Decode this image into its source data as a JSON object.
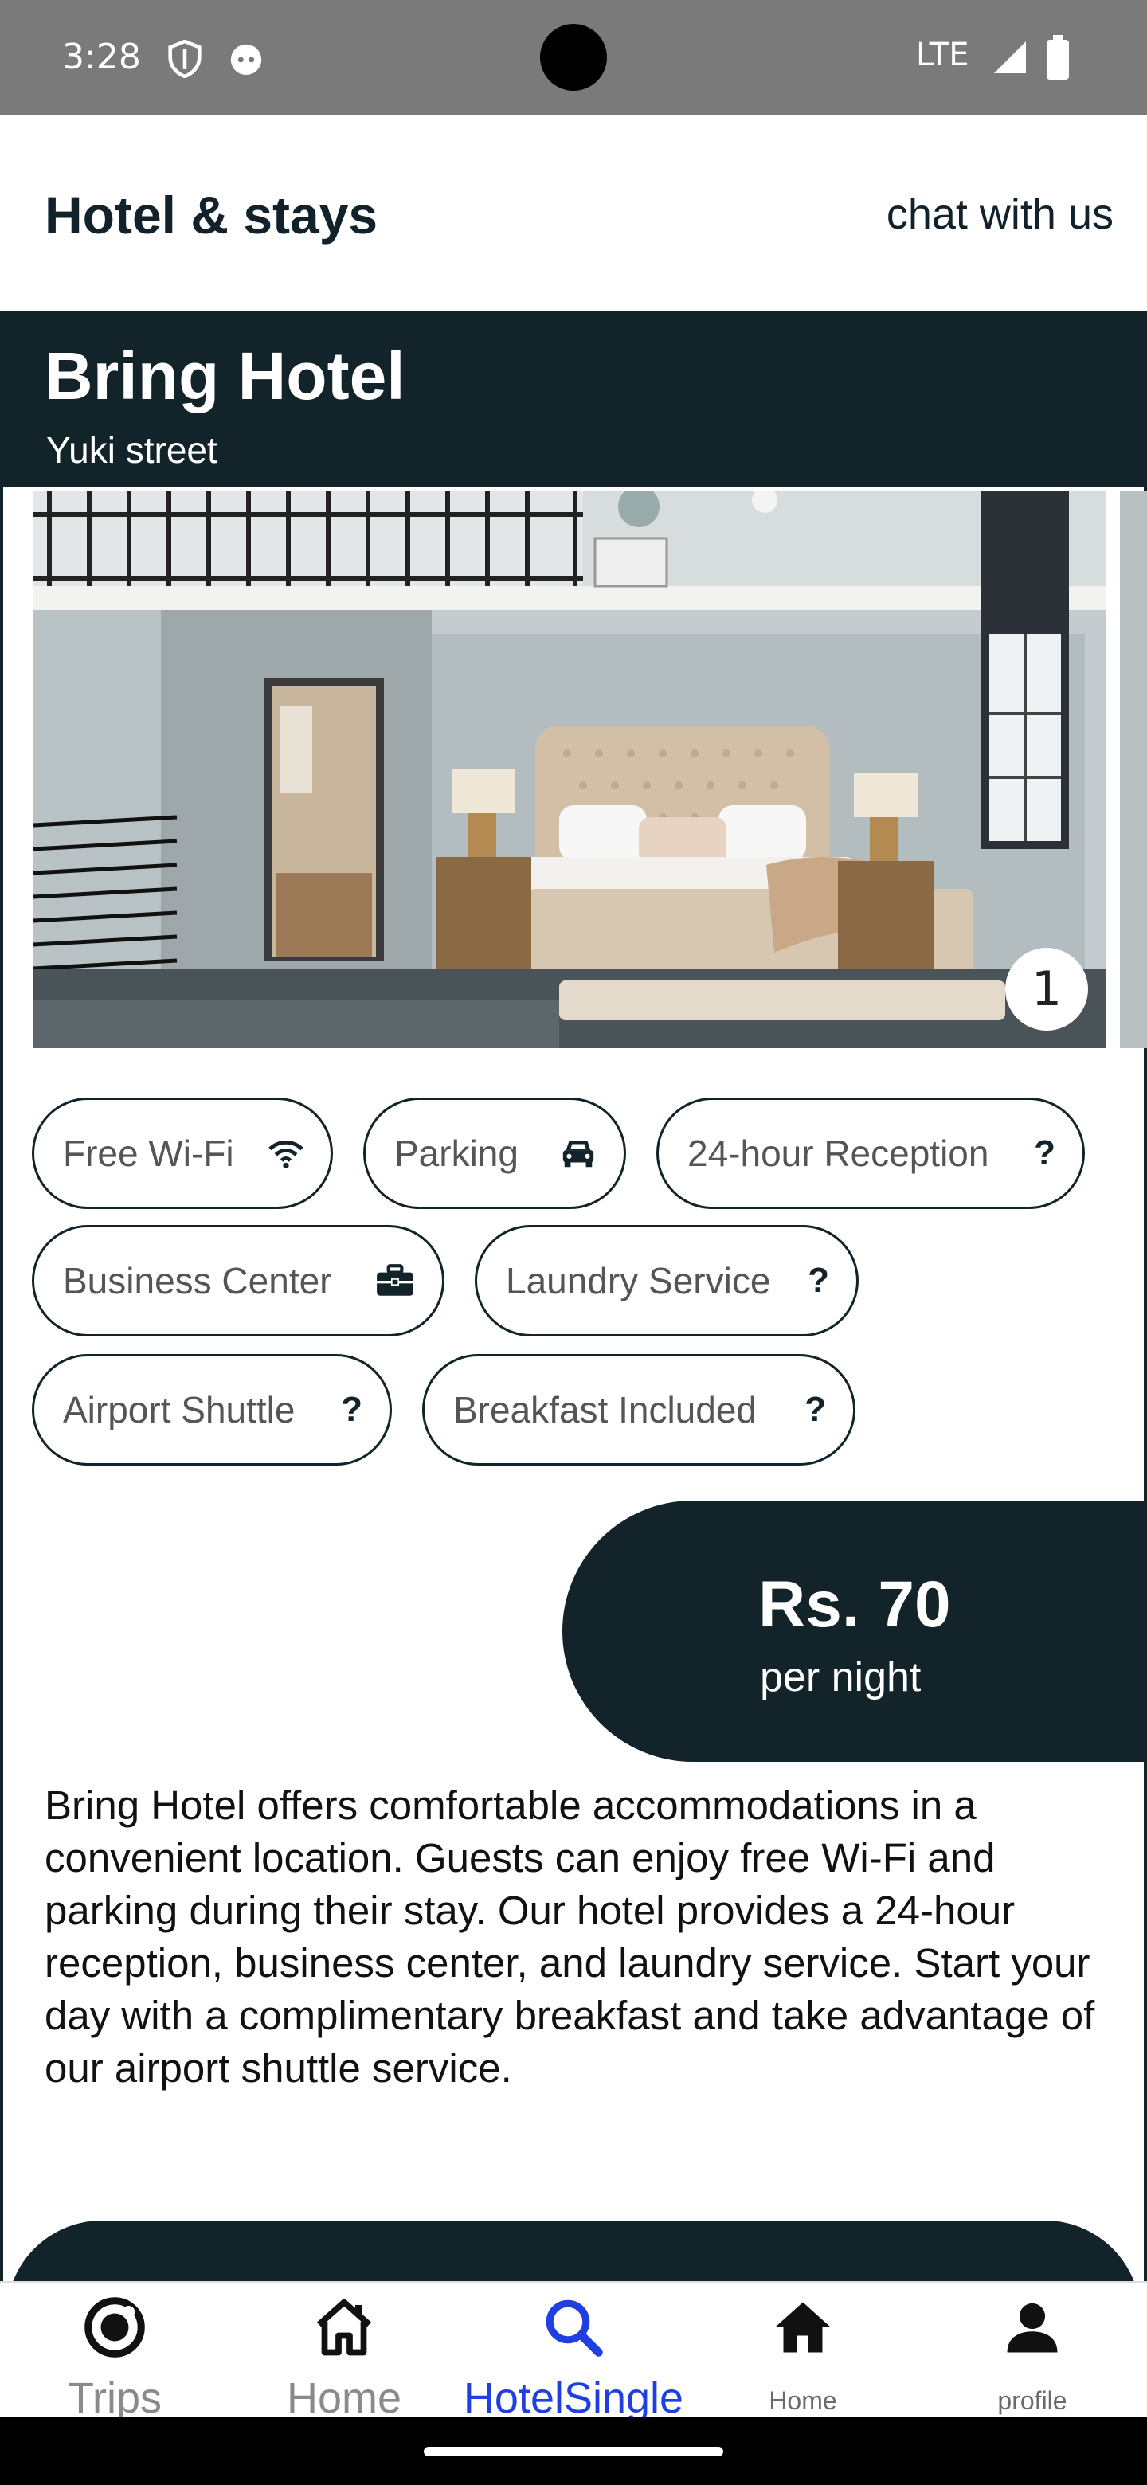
{
  "status_bar": {
    "time": "3:28",
    "network": "LTE"
  },
  "header": {
    "title": "Hotel & stays",
    "chat_link": "chat with us"
  },
  "hotel": {
    "name": "Bring Hotel",
    "street": "Yuki street"
  },
  "gallery": {
    "counter": "1"
  },
  "amenities": [
    {
      "label": "Free Wi-Fi",
      "icon": "wifi-icon"
    },
    {
      "label": "Parking",
      "icon": "car-icon"
    },
    {
      "label": "24-hour Reception",
      "icon": "question-icon"
    },
    {
      "label": "Business Center",
      "icon": "briefcase-icon"
    },
    {
      "label": "Laundry Service",
      "icon": "question-icon"
    },
    {
      "label": "Airport Shuttle",
      "icon": "question-icon"
    },
    {
      "label": "Breakfast Included",
      "icon": "question-icon"
    }
  ],
  "price": {
    "amount": "Rs. 70",
    "unit": "per night"
  },
  "description": "Bring Hotel offers comfortable accommodations in a convenient location. Guests can enjoy free Wi-Fi and parking during their stay. Our hotel provides a 24-hour reception, business center, and laundry service. Start your day with a complimentary breakfast and take advantage of our airport shuttle service.",
  "nav": {
    "items": [
      {
        "label": "Trips",
        "icon": "trips-icon"
      },
      {
        "label": "Home",
        "icon": "home-outline-icon"
      },
      {
        "label": "HotelSingle",
        "icon": "search-icon"
      },
      {
        "label": "Home",
        "icon": "home-filled-icon"
      },
      {
        "label": "profile",
        "icon": "person-icon"
      }
    ],
    "active_color": "#1f3fe0"
  },
  "colors": {
    "primary_dark": "#12232a",
    "status_bar": "#7a7a7a"
  }
}
